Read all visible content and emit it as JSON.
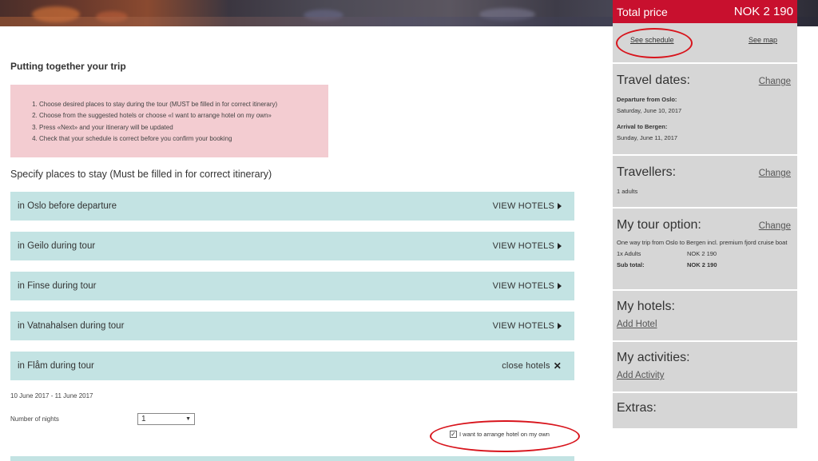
{
  "sidebar": {
    "price_label": "Total price",
    "price_value": "NOK 2 190",
    "see_schedule": "See schedule",
    "see_map": "See map",
    "travel_dates": {
      "title": "Travel dates:",
      "change": "Change",
      "departure_label": "Departure from Oslo:",
      "departure_value": "Saturday, June 10, 2017",
      "arrival_label": "Arrival to Bergen:",
      "arrival_value": "Sunday, June 11, 2017"
    },
    "travellers": {
      "title": "Travellers:",
      "change": "Change",
      "value": "1 adults"
    },
    "tour_option": {
      "title": "My tour option:",
      "change": "Change",
      "description": "One way trip from Oslo to Bergen incl. premium fjord cruise boat",
      "adults_label": "1x Adults",
      "adults_value": "NOK 2 190",
      "subtotal_label": "Sub total:",
      "subtotal_value": "NOK 2 190"
    },
    "hotels": {
      "title": "My hotels:",
      "add": "Add Hotel"
    },
    "activities": {
      "title": "My activities:",
      "add": "Add Activity"
    },
    "extras": {
      "title": "Extras:"
    }
  },
  "main": {
    "title": "Putting together your trip",
    "instructions": [
      "Choose desired places to stay during the tour (MUST be filled in for correct itinerary)",
      "Choose from the suggested hotels or choose «I want to arrange hotel on my own»",
      "Press «Next» and your itinerary will be updated",
      "Check that your schedule is correct before you confirm your booking"
    ],
    "specify_title": "Specify places to stay (Must be filled in for correct itinerary)",
    "stays": [
      {
        "label": "in Oslo before departure",
        "action": "VIEW HOTELS"
      },
      {
        "label": "in Geilo during tour",
        "action": "VIEW HOTELS"
      },
      {
        "label": "in Finse during tour",
        "action": "VIEW HOTELS"
      },
      {
        "label": "in Vatnahalsen during tour",
        "action": "VIEW HOTELS"
      },
      {
        "label": "in Flåm during tour",
        "action": "close hotels"
      }
    ],
    "date_range": "10 June 2017 - 11 June 2017",
    "nights_label": "Number of nights",
    "nights_value": "1",
    "own_hotel_label": "I want to arrange hotel on my own",
    "own_hotel_checked": true
  },
  "colors": {
    "accent_red": "#c8102e",
    "row_teal": "#c3e3e3",
    "instructions_pink": "#f3ccd1",
    "sidebar_gray": "#d6d6d6",
    "highlight_ring": "#d8141c"
  }
}
